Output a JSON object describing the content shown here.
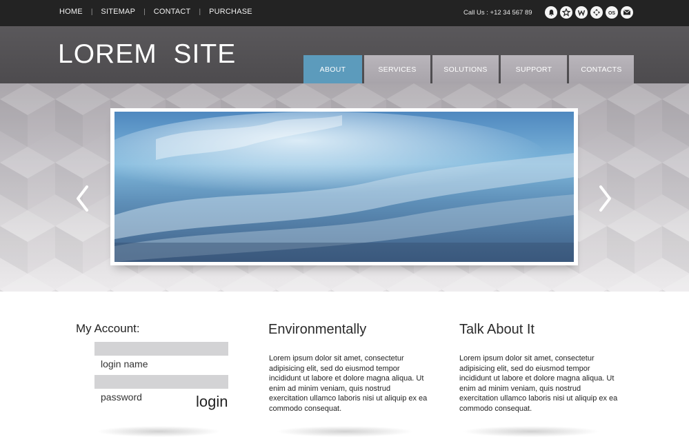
{
  "topbar": {
    "nav": [
      "HOME",
      "SITEMAP",
      "CONTACT",
      "PURCHASE"
    ],
    "phone": "Call Us : +12 34 567 89",
    "social_icons": [
      {
        "name": "bell-icon",
        "glyph": "♠"
      },
      {
        "name": "star-icon",
        "glyph": "★"
      },
      {
        "name": "w-icon",
        "glyph": "W"
      },
      {
        "name": "arrows-icon",
        "glyph": "✥"
      },
      {
        "name": "os-icon",
        "glyph": "OS"
      },
      {
        "name": "mail-icon",
        "glyph": "✉"
      }
    ]
  },
  "header": {
    "logo": "LOREM SITE",
    "tabs": [
      {
        "label": "ABOUT",
        "active": true
      },
      {
        "label": "SERVICES",
        "active": false
      },
      {
        "label": "SOLUTIONS",
        "active": false
      },
      {
        "label": "SUPPORT",
        "active": false
      },
      {
        "label": "CONTACTS",
        "active": false
      }
    ]
  },
  "slider": {
    "prev_icon": "chevron-left-icon",
    "next_icon": "chevron-right-icon"
  },
  "account": {
    "title": "My Account:",
    "login_label": "login name",
    "password_label": "password",
    "login_button": "login"
  },
  "columns": [
    {
      "title": "Environmentally",
      "text": "Lorem ipsum dolor sit amet, consectetur adipisicing elit, sed do eiusmod tempor incididunt ut labore et dolore magna aliqua. Ut enim ad minim veniam, quis nostrud exercitation ullamco laboris nisi ut aliquip ex ea commodo consequat."
    },
    {
      "title": "Talk About It",
      "text": "Lorem ipsum dolor sit amet, consectetur adipisicing elit, sed do eiusmod tempor incididunt ut labore et dolore magna aliqua. Ut enim ad minim veniam, quis nostrud exercitation ullamco laboris nisi ut aliquip ex ea commodo consequat."
    }
  ],
  "colors": {
    "topbar": "#232323",
    "header": "#545255",
    "active_tab": "#5c9bbc",
    "inactive_tab": "#b0acb2",
    "field": "#d3d3d5"
  }
}
